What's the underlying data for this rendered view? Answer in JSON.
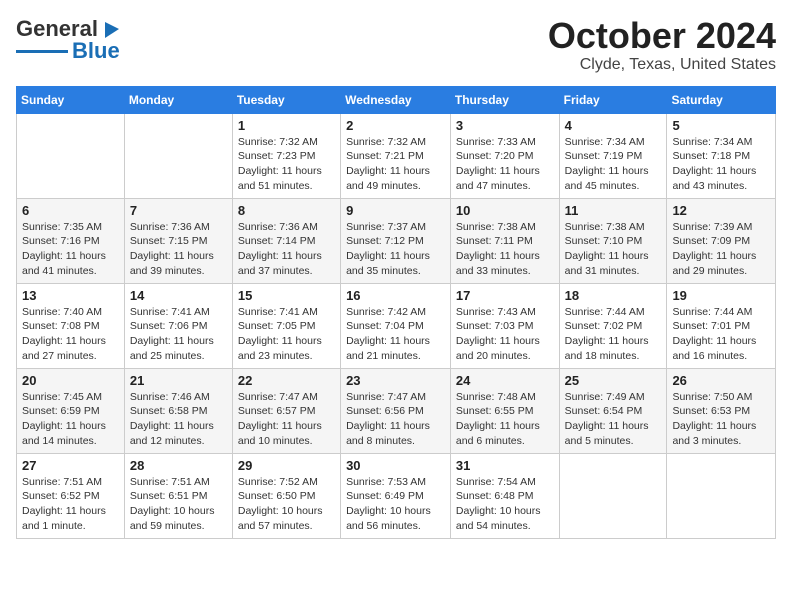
{
  "logo": {
    "text1": "General",
    "text2": "Blue"
  },
  "title": "October 2024",
  "location": "Clyde, Texas, United States",
  "headers": [
    "Sunday",
    "Monday",
    "Tuesday",
    "Wednesday",
    "Thursday",
    "Friday",
    "Saturday"
  ],
  "weeks": [
    [
      {
        "day": "",
        "sunrise": "",
        "sunset": "",
        "daylight": ""
      },
      {
        "day": "",
        "sunrise": "",
        "sunset": "",
        "daylight": ""
      },
      {
        "day": "1",
        "sunrise": "Sunrise: 7:32 AM",
        "sunset": "Sunset: 7:23 PM",
        "daylight": "Daylight: 11 hours and 51 minutes."
      },
      {
        "day": "2",
        "sunrise": "Sunrise: 7:32 AM",
        "sunset": "Sunset: 7:21 PM",
        "daylight": "Daylight: 11 hours and 49 minutes."
      },
      {
        "day": "3",
        "sunrise": "Sunrise: 7:33 AM",
        "sunset": "Sunset: 7:20 PM",
        "daylight": "Daylight: 11 hours and 47 minutes."
      },
      {
        "day": "4",
        "sunrise": "Sunrise: 7:34 AM",
        "sunset": "Sunset: 7:19 PM",
        "daylight": "Daylight: 11 hours and 45 minutes."
      },
      {
        "day": "5",
        "sunrise": "Sunrise: 7:34 AM",
        "sunset": "Sunset: 7:18 PM",
        "daylight": "Daylight: 11 hours and 43 minutes."
      }
    ],
    [
      {
        "day": "6",
        "sunrise": "Sunrise: 7:35 AM",
        "sunset": "Sunset: 7:16 PM",
        "daylight": "Daylight: 11 hours and 41 minutes."
      },
      {
        "day": "7",
        "sunrise": "Sunrise: 7:36 AM",
        "sunset": "Sunset: 7:15 PM",
        "daylight": "Daylight: 11 hours and 39 minutes."
      },
      {
        "day": "8",
        "sunrise": "Sunrise: 7:36 AM",
        "sunset": "Sunset: 7:14 PM",
        "daylight": "Daylight: 11 hours and 37 minutes."
      },
      {
        "day": "9",
        "sunrise": "Sunrise: 7:37 AM",
        "sunset": "Sunset: 7:12 PM",
        "daylight": "Daylight: 11 hours and 35 minutes."
      },
      {
        "day": "10",
        "sunrise": "Sunrise: 7:38 AM",
        "sunset": "Sunset: 7:11 PM",
        "daylight": "Daylight: 11 hours and 33 minutes."
      },
      {
        "day": "11",
        "sunrise": "Sunrise: 7:38 AM",
        "sunset": "Sunset: 7:10 PM",
        "daylight": "Daylight: 11 hours and 31 minutes."
      },
      {
        "day": "12",
        "sunrise": "Sunrise: 7:39 AM",
        "sunset": "Sunset: 7:09 PM",
        "daylight": "Daylight: 11 hours and 29 minutes."
      }
    ],
    [
      {
        "day": "13",
        "sunrise": "Sunrise: 7:40 AM",
        "sunset": "Sunset: 7:08 PM",
        "daylight": "Daylight: 11 hours and 27 minutes."
      },
      {
        "day": "14",
        "sunrise": "Sunrise: 7:41 AM",
        "sunset": "Sunset: 7:06 PM",
        "daylight": "Daylight: 11 hours and 25 minutes."
      },
      {
        "day": "15",
        "sunrise": "Sunrise: 7:41 AM",
        "sunset": "Sunset: 7:05 PM",
        "daylight": "Daylight: 11 hours and 23 minutes."
      },
      {
        "day": "16",
        "sunrise": "Sunrise: 7:42 AM",
        "sunset": "Sunset: 7:04 PM",
        "daylight": "Daylight: 11 hours and 21 minutes."
      },
      {
        "day": "17",
        "sunrise": "Sunrise: 7:43 AM",
        "sunset": "Sunset: 7:03 PM",
        "daylight": "Daylight: 11 hours and 20 minutes."
      },
      {
        "day": "18",
        "sunrise": "Sunrise: 7:44 AM",
        "sunset": "Sunset: 7:02 PM",
        "daylight": "Daylight: 11 hours and 18 minutes."
      },
      {
        "day": "19",
        "sunrise": "Sunrise: 7:44 AM",
        "sunset": "Sunset: 7:01 PM",
        "daylight": "Daylight: 11 hours and 16 minutes."
      }
    ],
    [
      {
        "day": "20",
        "sunrise": "Sunrise: 7:45 AM",
        "sunset": "Sunset: 6:59 PM",
        "daylight": "Daylight: 11 hours and 14 minutes."
      },
      {
        "day": "21",
        "sunrise": "Sunrise: 7:46 AM",
        "sunset": "Sunset: 6:58 PM",
        "daylight": "Daylight: 11 hours and 12 minutes."
      },
      {
        "day": "22",
        "sunrise": "Sunrise: 7:47 AM",
        "sunset": "Sunset: 6:57 PM",
        "daylight": "Daylight: 11 hours and 10 minutes."
      },
      {
        "day": "23",
        "sunrise": "Sunrise: 7:47 AM",
        "sunset": "Sunset: 6:56 PM",
        "daylight": "Daylight: 11 hours and 8 minutes."
      },
      {
        "day": "24",
        "sunrise": "Sunrise: 7:48 AM",
        "sunset": "Sunset: 6:55 PM",
        "daylight": "Daylight: 11 hours and 6 minutes."
      },
      {
        "day": "25",
        "sunrise": "Sunrise: 7:49 AM",
        "sunset": "Sunset: 6:54 PM",
        "daylight": "Daylight: 11 hours and 5 minutes."
      },
      {
        "day": "26",
        "sunrise": "Sunrise: 7:50 AM",
        "sunset": "Sunset: 6:53 PM",
        "daylight": "Daylight: 11 hours and 3 minutes."
      }
    ],
    [
      {
        "day": "27",
        "sunrise": "Sunrise: 7:51 AM",
        "sunset": "Sunset: 6:52 PM",
        "daylight": "Daylight: 11 hours and 1 minute."
      },
      {
        "day": "28",
        "sunrise": "Sunrise: 7:51 AM",
        "sunset": "Sunset: 6:51 PM",
        "daylight": "Daylight: 10 hours and 59 minutes."
      },
      {
        "day": "29",
        "sunrise": "Sunrise: 7:52 AM",
        "sunset": "Sunset: 6:50 PM",
        "daylight": "Daylight: 10 hours and 57 minutes."
      },
      {
        "day": "30",
        "sunrise": "Sunrise: 7:53 AM",
        "sunset": "Sunset: 6:49 PM",
        "daylight": "Daylight: 10 hours and 56 minutes."
      },
      {
        "day": "31",
        "sunrise": "Sunrise: 7:54 AM",
        "sunset": "Sunset: 6:48 PM",
        "daylight": "Daylight: 10 hours and 54 minutes."
      },
      {
        "day": "",
        "sunrise": "",
        "sunset": "",
        "daylight": ""
      },
      {
        "day": "",
        "sunrise": "",
        "sunset": "",
        "daylight": ""
      }
    ]
  ]
}
